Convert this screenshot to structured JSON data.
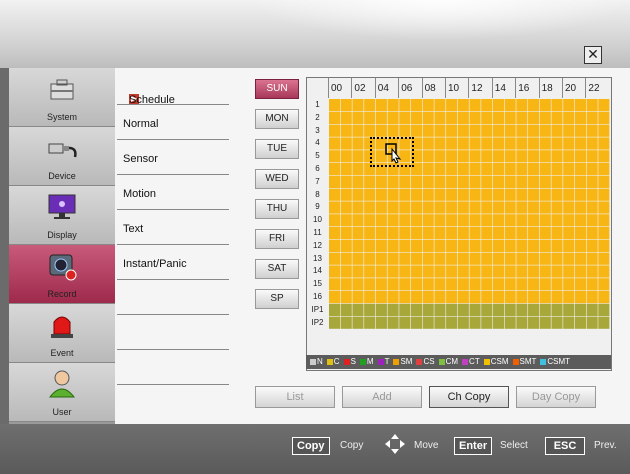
{
  "window": {
    "close_glyph": "✕"
  },
  "nav": [
    {
      "label": "System",
      "icon": "toolbox-icon"
    },
    {
      "label": "Device",
      "icon": "usb-cable-icon"
    },
    {
      "label": "Display",
      "icon": "monitor-icon"
    },
    {
      "label": "Record",
      "icon": "camera-icon",
      "active": true
    },
    {
      "label": "Event",
      "icon": "alarm-light-icon"
    },
    {
      "label": "User",
      "icon": "person-icon"
    }
  ],
  "submenu": {
    "title": "Schedule",
    "items": [
      "Normal",
      "Sensor",
      "Motion",
      "Text",
      "Instant/Panic"
    ]
  },
  "days": [
    "SUN",
    "MON",
    "TUE",
    "WED",
    "THU",
    "FRI",
    "SAT",
    "SP"
  ],
  "active_day": "SUN",
  "hours": [
    "00",
    "02",
    "04",
    "06",
    "08",
    "10",
    "12",
    "14",
    "16",
    "18",
    "20",
    "22"
  ],
  "rows": [
    "1",
    "2",
    "3",
    "4",
    "5",
    "6",
    "7",
    "8",
    "9",
    "10",
    "11",
    "12",
    "13",
    "14",
    "15",
    "16",
    "IP1",
    "IP2"
  ],
  "colors": {
    "schedule_fill": "#f7b614",
    "ip_fill": "#a8a83a",
    "accent": "#b33a5c"
  },
  "legend": [
    {
      "code": "N",
      "color": "#cccccc"
    },
    {
      "code": "C",
      "color": "#e0c010"
    },
    {
      "code": "S",
      "color": "#e02020"
    },
    {
      "code": "M",
      "color": "#20a020"
    },
    {
      "code": "T",
      "color": "#a020c0"
    },
    {
      "code": "SM",
      "color": "#f0a000"
    },
    {
      "code": "CS",
      "color": "#e04040"
    },
    {
      "code": "CM",
      "color": "#80c040"
    },
    {
      "code": "CT",
      "color": "#c040c0"
    },
    {
      "code": "CSM",
      "color": "#f0c000"
    },
    {
      "code": "SMT",
      "color": "#f06000"
    },
    {
      "code": "CSMT",
      "color": "#40c0e0"
    }
  ],
  "buttons": {
    "list": "List",
    "add": "Add",
    "ch_copy": "Ch Copy",
    "day_copy": "Day Copy"
  },
  "footer": {
    "copy_key": "Copy",
    "copy_label": "Copy",
    "move_label": "Move",
    "enter_key": "Enter",
    "enter_label": "Select",
    "esc_key": "ESC",
    "esc_label": "Prev."
  }
}
